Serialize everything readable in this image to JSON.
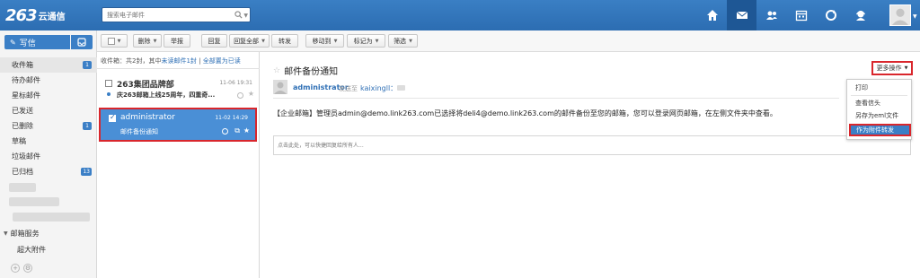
{
  "header": {
    "logo_mark": "263",
    "logo_text": "云通信",
    "search_placeholder": "搜索电子邮件",
    "nav": [
      {
        "name": "home-icon",
        "active": false
      },
      {
        "name": "mail-icon",
        "active": true
      },
      {
        "name": "contacts-icon",
        "active": false
      },
      {
        "name": "calendar-icon",
        "active": false
      },
      {
        "name": "sync-icon",
        "active": false
      },
      {
        "name": "support-icon",
        "active": false
      }
    ]
  },
  "sidebar": {
    "compose_label": "写信",
    "folders": [
      {
        "label": "收件箱",
        "badge": "1"
      },
      {
        "label": "待办邮件",
        "badge": ""
      },
      {
        "label": "星标邮件",
        "badge": ""
      },
      {
        "label": "已发送",
        "badge": ""
      },
      {
        "label": "已删除",
        "badge": "1"
      },
      {
        "label": "草稿",
        "badge": ""
      },
      {
        "label": "垃圾邮件",
        "badge": ""
      },
      {
        "label": "已归档",
        "badge": "13"
      }
    ],
    "section_label": "邮箱服务",
    "service_item": "超大附件"
  },
  "toolbar": {
    "delete": "删除",
    "report": "举报",
    "reply": "回复",
    "reply_all": "回复全部",
    "forward": "转发",
    "move_to": "移动到",
    "mark_as": "标记为",
    "filter": "筛选"
  },
  "list": {
    "info_text": "收件箱：共2封，其中",
    "unread_link": "未读邮件1封",
    "mark_read_link": "全部置为已读",
    "messages": [
      {
        "sender": "263集团品牌部",
        "time": "11-06 19:31",
        "subject": "庆263邮箱上线25周年，四重奇...",
        "unread": true,
        "selected": false
      },
      {
        "sender": "administrator",
        "time": "11-02 14:29",
        "subject": "邮件备份通知",
        "unread": false,
        "selected": true
      }
    ]
  },
  "reader": {
    "subject": "邮件备份通知",
    "more_ops": "更多操作",
    "sender": "administrator",
    "sent_to_label": "发送至",
    "recipient": "kaixingll：",
    "body": "【企业邮箱】管理员admin@demo.link263.com已选择将deli4@demo.link263.com的邮件备份至您的邮箱，您可以登录网页邮箱，在左侧文件夹中查看。",
    "reply_placeholder": "点击此处，可以快捷回复给所有人..."
  },
  "menu": {
    "items": [
      {
        "label": "打印",
        "highlighted": false
      },
      {
        "label": "查看信头",
        "highlighted": false
      },
      {
        "label": "另存为eml文件",
        "highlighted": false
      },
      {
        "label": "作为附件转发",
        "highlighted": true
      }
    ]
  },
  "colors": {
    "header_blue": "#2c6db2",
    "accent": "#3b7fc6",
    "highlight_border": "#d9262c"
  }
}
